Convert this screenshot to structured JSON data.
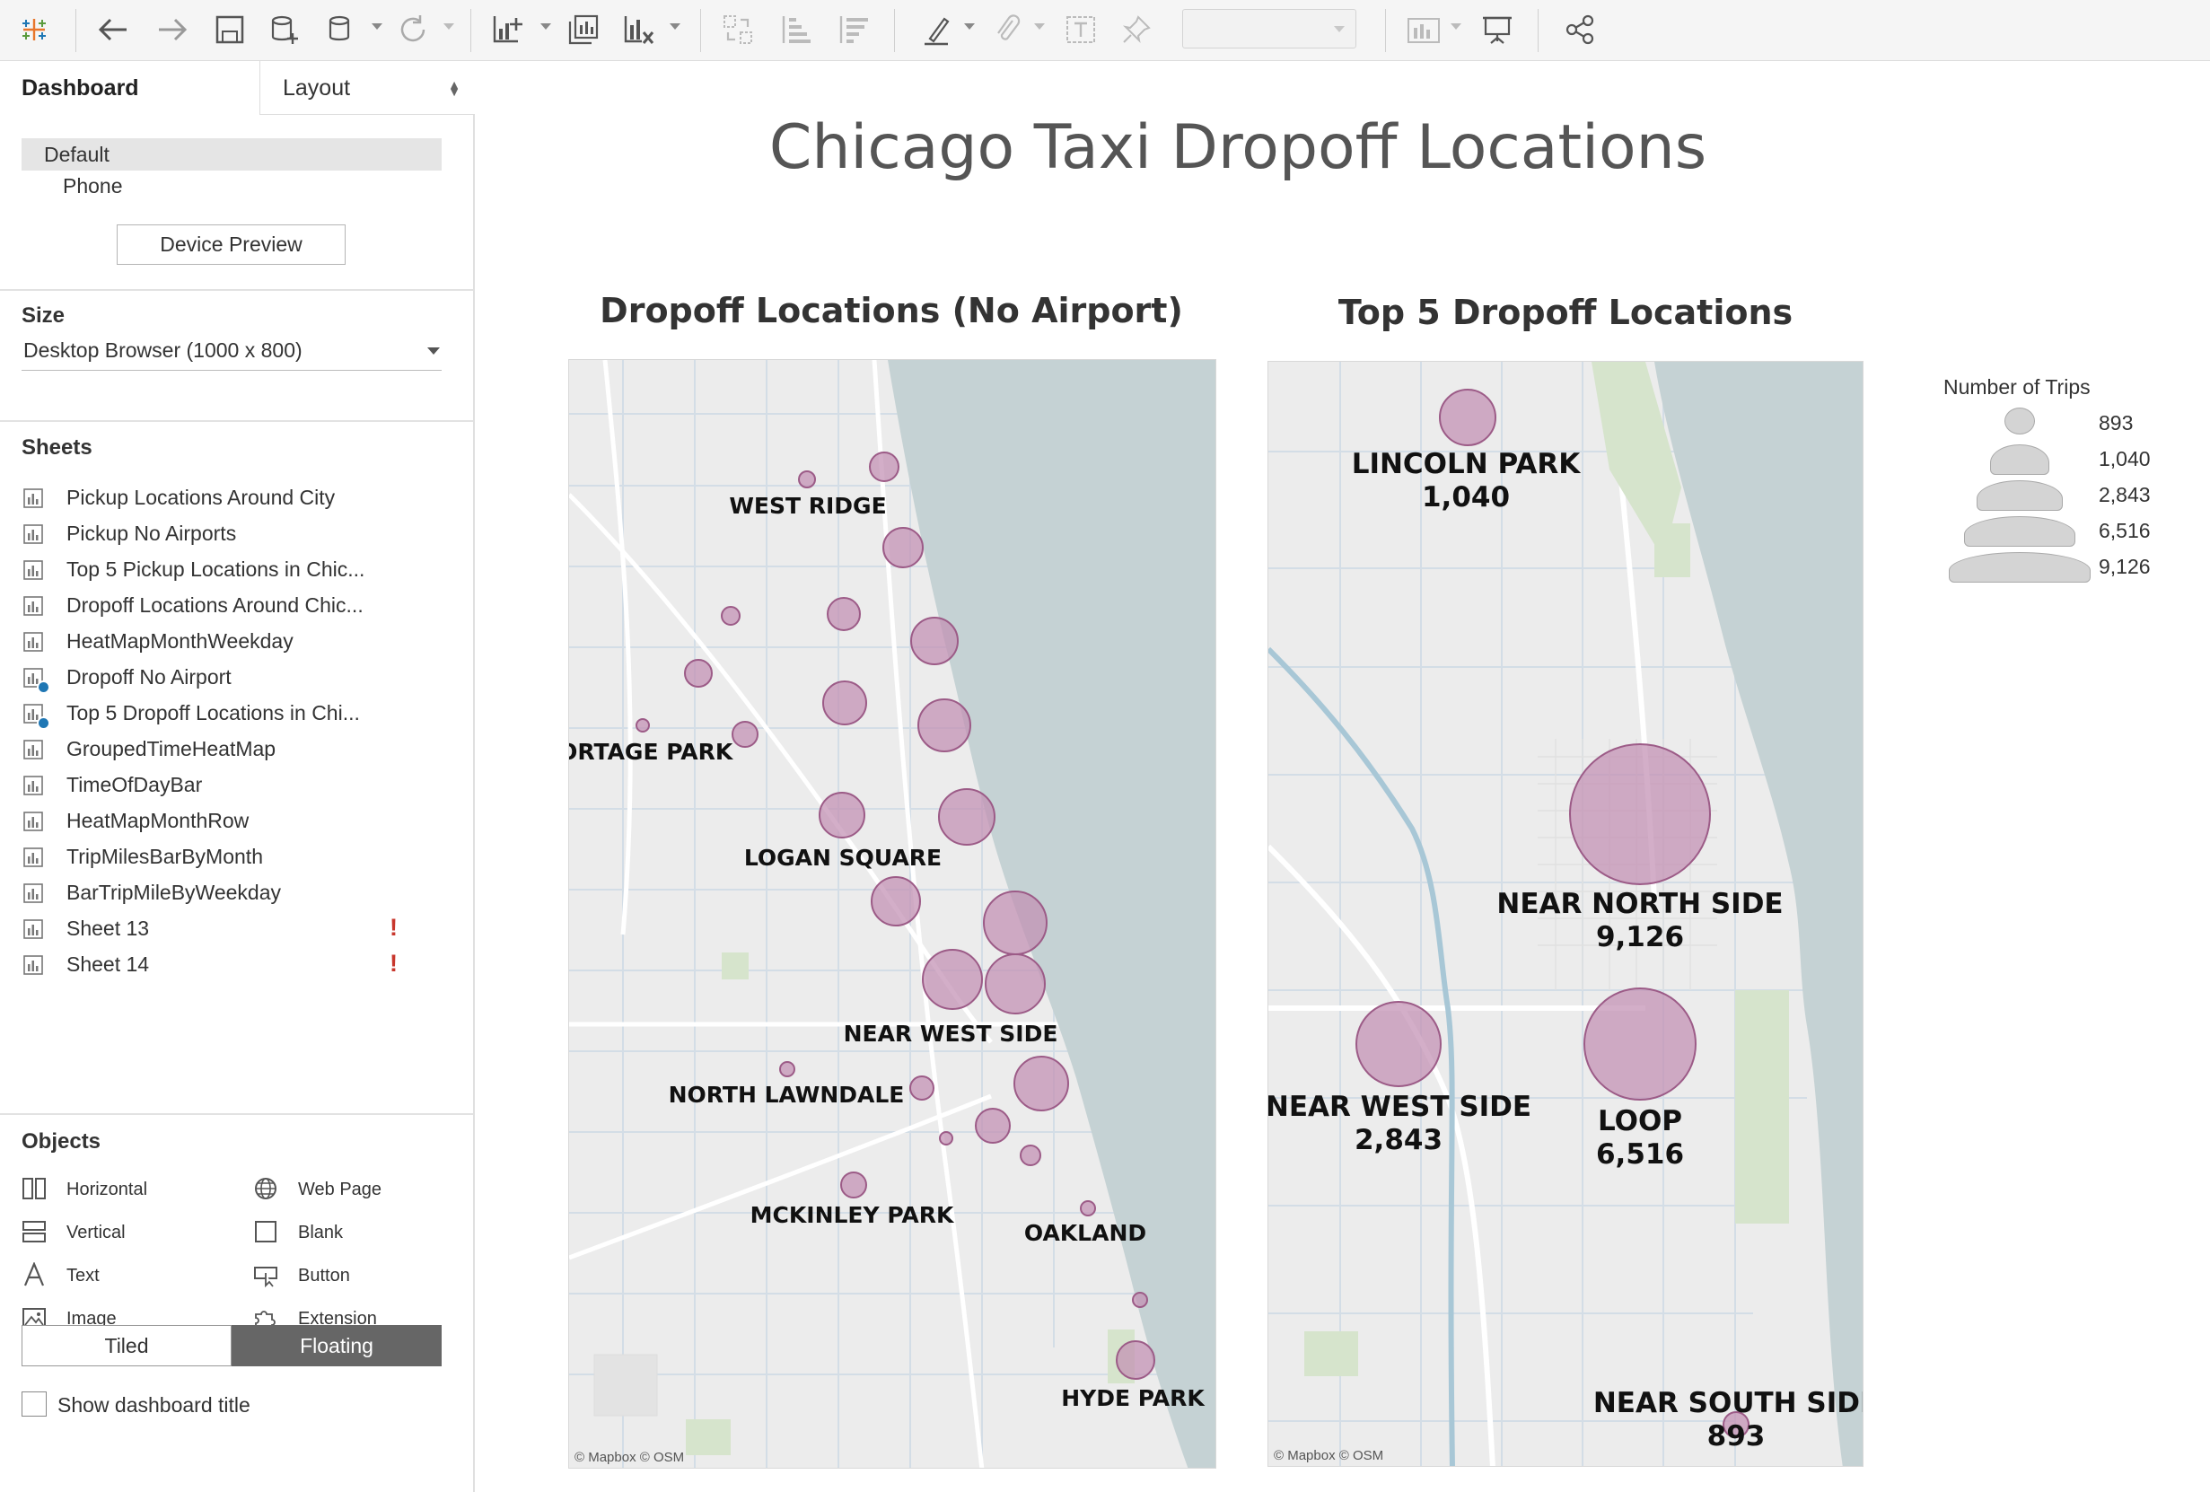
{
  "left_panel": {
    "tabs": {
      "dashboard": "Dashboard",
      "layout": "Layout"
    },
    "device_layouts": [
      "Default",
      "Phone"
    ],
    "device_preview_label": "Device Preview",
    "size": {
      "title": "Size",
      "value": "Desktop Browser (1000 x 800)"
    },
    "sheets": {
      "title": "Sheets",
      "items": [
        {
          "label": "Pickup Locations Around City"
        },
        {
          "label": "Pickup No Airports"
        },
        {
          "label": "Top 5 Pickup Locations in Chic..."
        },
        {
          "label": "Dropoff Locations Around Chic..."
        },
        {
          "label": "HeatMapMonthWeekday"
        },
        {
          "label": "Dropoff No Airport"
        },
        {
          "label": "Top 5 Dropoff Locations in Chi..."
        },
        {
          "label": "GroupedTimeHeatMap"
        },
        {
          "label": "TimeOfDayBar"
        },
        {
          "label": "HeatMapMonthRow"
        },
        {
          "label": "TripMilesBarByMonth"
        },
        {
          "label": "BarTripMileByWeekday"
        },
        {
          "label": "Sheet 13",
          "warning": "!"
        },
        {
          "label": "Sheet 14",
          "warning": "!"
        }
      ]
    },
    "objects": {
      "title": "Objects",
      "items": [
        {
          "label": "Horizontal",
          "icon": "horizontal-layout-icon"
        },
        {
          "label": "Web Page",
          "icon": "globe-icon"
        },
        {
          "label": "Vertical",
          "icon": "vertical-layout-icon"
        },
        {
          "label": "Blank",
          "icon": "blank-icon"
        },
        {
          "label": "Text",
          "icon": "text-icon"
        },
        {
          "label": "Button",
          "icon": "button-icon"
        },
        {
          "label": "Image",
          "icon": "image-icon"
        },
        {
          "label": "Extension",
          "icon": "puzzle-icon"
        }
      ]
    },
    "placement": {
      "tiled": "Tiled",
      "floating": "Floating",
      "selected": "Floating"
    },
    "show_title_label": "Show dashboard title"
  },
  "dashboard": {
    "title": "Chicago Taxi Dropoff Locations",
    "map1": {
      "title": "Dropoff Locations (No Airport)",
      "labels": [
        "WEST RIDGE",
        "PORTAGE PARK",
        "LOGAN SQUARE",
        "NEAR WEST SIDE",
        "NORTH LAWNDALE",
        "MCKINLEY PARK",
        "OAKLAND",
        "HYDE PARK"
      ],
      "attribution": "© Mapbox © OSM"
    },
    "map2": {
      "title": "Top 5 Dropoff Locations",
      "locations": [
        {
          "name": "LINCOLN PARK",
          "trips": "1,040"
        },
        {
          "name": "NEAR NORTH SIDE",
          "trips": "9,126"
        },
        {
          "name": "NEAR WEST SIDE",
          "trips": "2,843"
        },
        {
          "name": "LOOP",
          "trips": "6,516"
        },
        {
          "name": "NEAR SOUTH SIDE",
          "trips": "893"
        }
      ],
      "attribution": "© Mapbox © OSM"
    },
    "legend": {
      "title": "Number of Trips",
      "values": [
        "893",
        "1,040",
        "2,843",
        "6,516",
        "9,126"
      ]
    }
  },
  "colors": {
    "bubble_fill": "#c28fb3",
    "bubble_stroke": "#9c5b87",
    "water": "#c5d2d4",
    "land": "#ececec",
    "park": "#d6e4cc",
    "warning": "#c8372d",
    "selected_toggle": "#666666"
  }
}
